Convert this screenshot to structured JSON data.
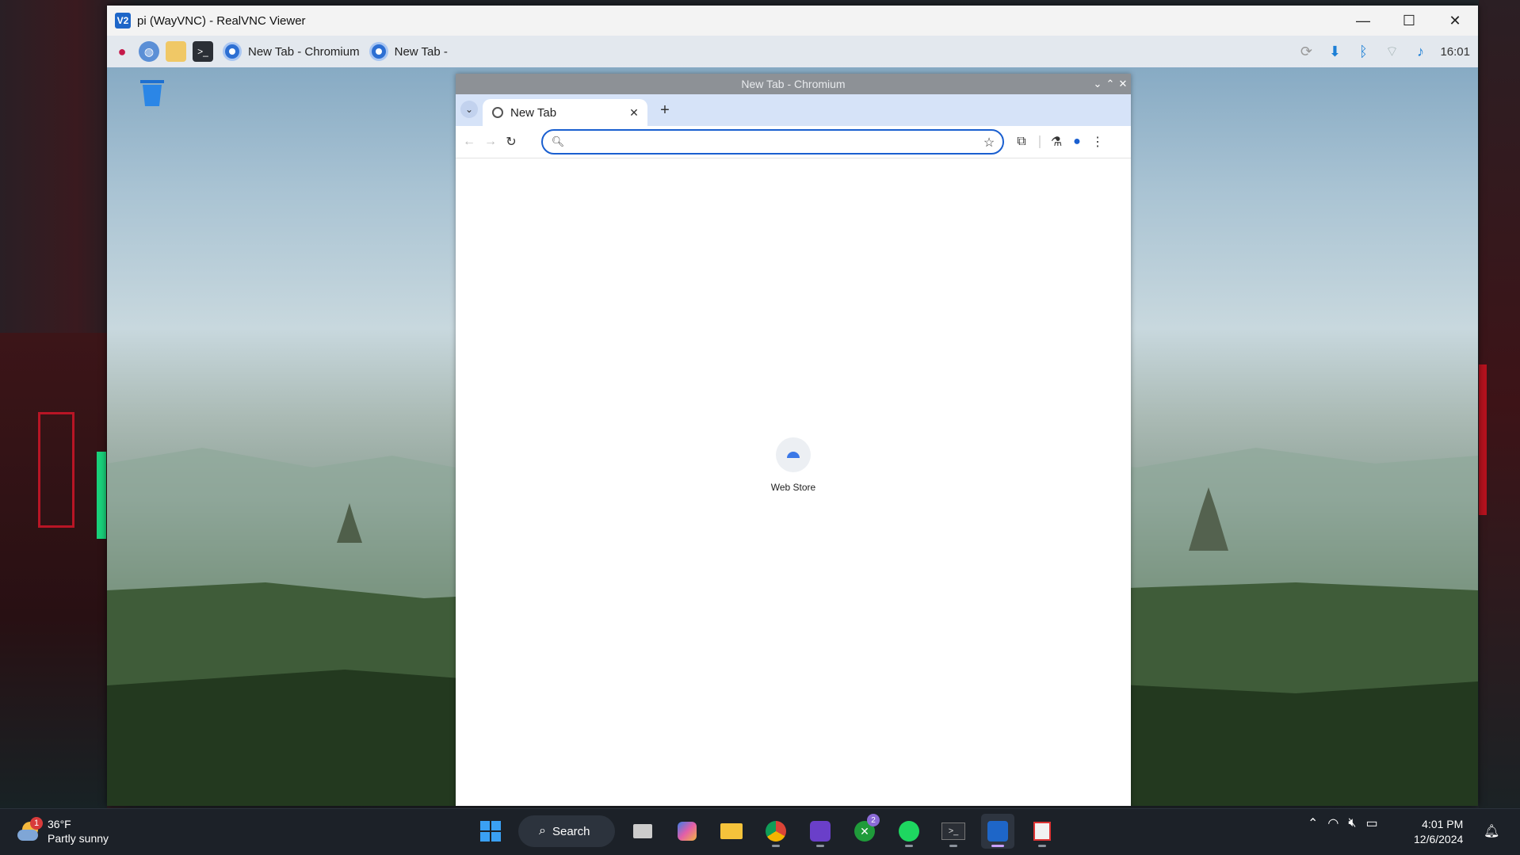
{
  "vnc": {
    "title": "pi (WayVNC) - RealVNC Viewer",
    "icon_letter": "V2",
    "minimize": "—",
    "maximize": "☐",
    "close": "✕"
  },
  "pi_panel": {
    "tasks": [
      {
        "label": "New Tab - Chromium"
      },
      {
        "label": "New Tab -"
      }
    ],
    "clock": "16:01"
  },
  "chromium": {
    "window_title": "New Tab - Chromium",
    "tab_title": "New Tab",
    "omnibox_value": "",
    "shortcut": {
      "label": "Web Store"
    }
  },
  "windows": {
    "weather": {
      "temp": "36°F",
      "condition": "Partly sunny",
      "badge": "1"
    },
    "search_label": "Search",
    "xbox_badge": "2",
    "time": "4:01 PM",
    "date": "12/6/2024"
  },
  "colors": {
    "accent": "#1a5fd0",
    "tab_strip": "#d6e3f8",
    "taskbar": "#1c2128"
  }
}
